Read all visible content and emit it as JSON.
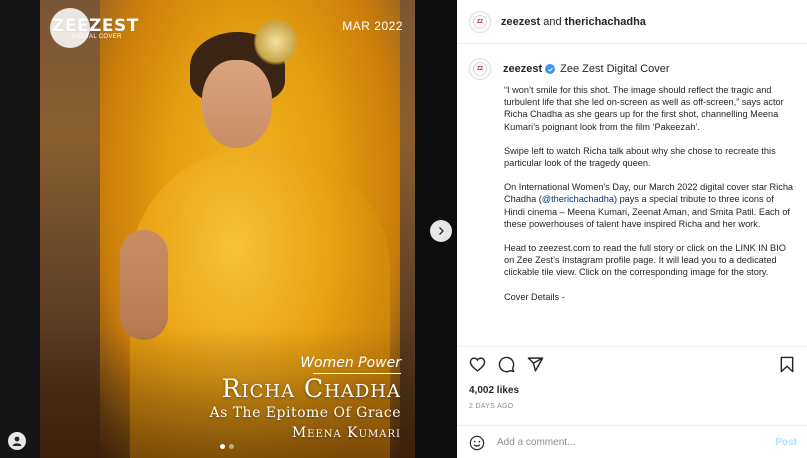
{
  "colors": {
    "panel_bg": "#ffffff",
    "text": "#262626",
    "muted": "#8e8e8e",
    "link": "#00376b",
    "post_disabled": "#b2dffc",
    "verified": "#3897f0",
    "brand": "#a7164a",
    "saffron": "#e7a114"
  },
  "media": {
    "logo_word": "ZEEZEST",
    "logo_sub": "DIGITAL COVER",
    "issue_date": "MAR 2022",
    "women_power": "Women Power",
    "cover_name": "Richa Chadha",
    "cover_tagline": "As The Epitome Of Grace",
    "cover_subject": "Meena Kumari",
    "carousel_count": 2,
    "carousel_active": 0
  },
  "header": {
    "account": "zeezest",
    "joiner": "and",
    "collaborator": "therichachadha"
  },
  "caption": {
    "author": "zeezest",
    "full_name": "Zee Zest Digital Cover",
    "p1": "“I won’t smile for this shot. The image should reflect the tragic and turbulent life that she led on-screen as well as off-screen,” says actor Richa Chadha as she gears up for the first shot, channelling Meena Kumari’s poignant look from the film ‘Pakeezah’.",
    "p2": "Swipe left to watch Richa talk about why she chose to recreate this particular look of the tragedy queen.",
    "p3_start": "On International Women’s Day, our March 2022 digital cover star Richa Chadha (",
    "p3_mention": "@therichachadha",
    "p3_end": ") pays a special tribute to three icons of Hindi cinema – Meena Kumari, Zeenat Aman, and Smita Patil. Each of these powerhouses of talent have inspired Richa and her work.",
    "p4": "Head to zeezest.com to read the full story or click on the LINK IN BIO on Zee Zest’s Instagram profile page. It will lead you to a dedicated clickable tile view. Click on the corresponding image for the story.",
    "p5": "Cover Details -"
  },
  "actions": {
    "likes": "4,002 likes",
    "date": "2 DAYS AGO",
    "comment_placeholder": "Add a comment...",
    "post_label": "Post"
  },
  "icons": {
    "like": "heart-icon",
    "comment": "comment-icon",
    "share": "share-icon",
    "save": "bookmark-icon",
    "emoji": "smiley-icon",
    "next": "chevron-right-icon",
    "verified": "verified-badge-icon",
    "profile": "user-icon"
  }
}
